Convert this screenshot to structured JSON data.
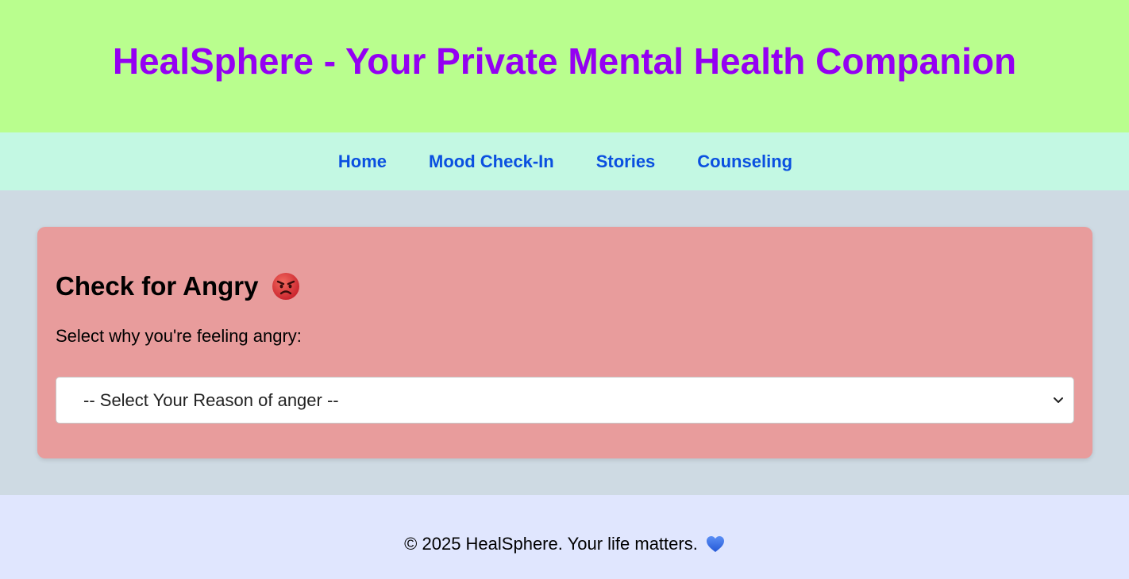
{
  "header": {
    "title": "HealSphere - Your Private Mental Health Companion"
  },
  "nav": {
    "items": [
      {
        "label": "Home"
      },
      {
        "label": "Mood Check-In"
      },
      {
        "label": "Stories"
      },
      {
        "label": "Counseling"
      }
    ]
  },
  "card": {
    "heading": "Check for Angry",
    "heading_icon": "angry-face-icon",
    "prompt": "Select why you're feeling angry:",
    "select": {
      "selected_value": "-- Select Your Reason of anger --"
    }
  },
  "footer": {
    "text": "© 2025 HealSphere. Your life matters.",
    "icon": "blue-heart-icon"
  },
  "colors": {
    "header_bg": "#b9fe8e",
    "title": "#9400f2",
    "nav_bg": "#c3f8e3",
    "nav_link": "#0a50e0",
    "main_bg": "#cedae3",
    "card_bg": "#e89c9c",
    "footer_bg": "#e0e6fe"
  }
}
